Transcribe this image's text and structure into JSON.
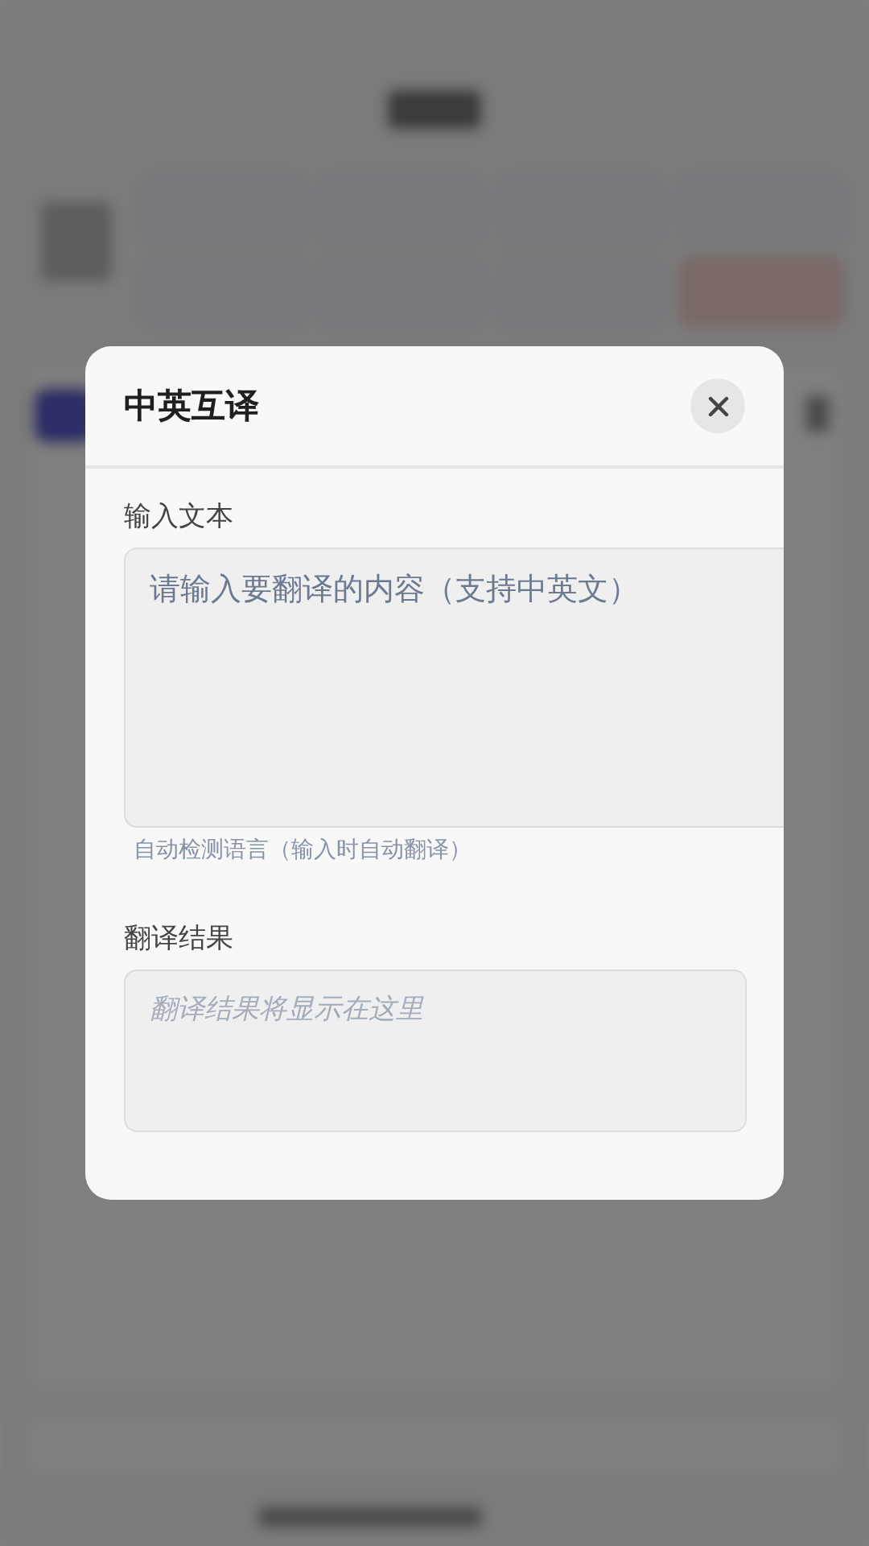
{
  "dialog": {
    "title": "中英互译",
    "input": {
      "label": "输入文本",
      "placeholder": "请输入要翻译的内容（支持中英文）",
      "hint": "自动检测语言（输入时自动翻译）"
    },
    "result": {
      "label": "翻译结果",
      "placeholder": "翻译结果将显示在这里"
    }
  }
}
